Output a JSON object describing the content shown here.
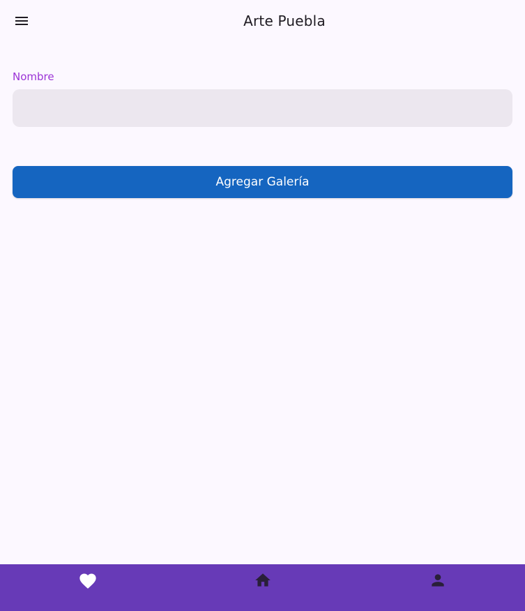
{
  "app_title": "Arte Puebla",
  "form": {
    "name_label": "Nombre",
    "name_value": "",
    "name_placeholder": ""
  },
  "actions": {
    "add_gallery_label": "Agregar Galería"
  },
  "bottom_nav": {
    "items": [
      {
        "icon": "heart-icon"
      },
      {
        "icon": "home-icon"
      },
      {
        "icon": "person-icon"
      }
    ]
  },
  "colors": {
    "background": "#fcf8ff",
    "label_accent": "#9b33d6",
    "input_fill": "#ece7ef",
    "primary_button": "#1565c0",
    "bottom_nav": "#673ab7"
  }
}
